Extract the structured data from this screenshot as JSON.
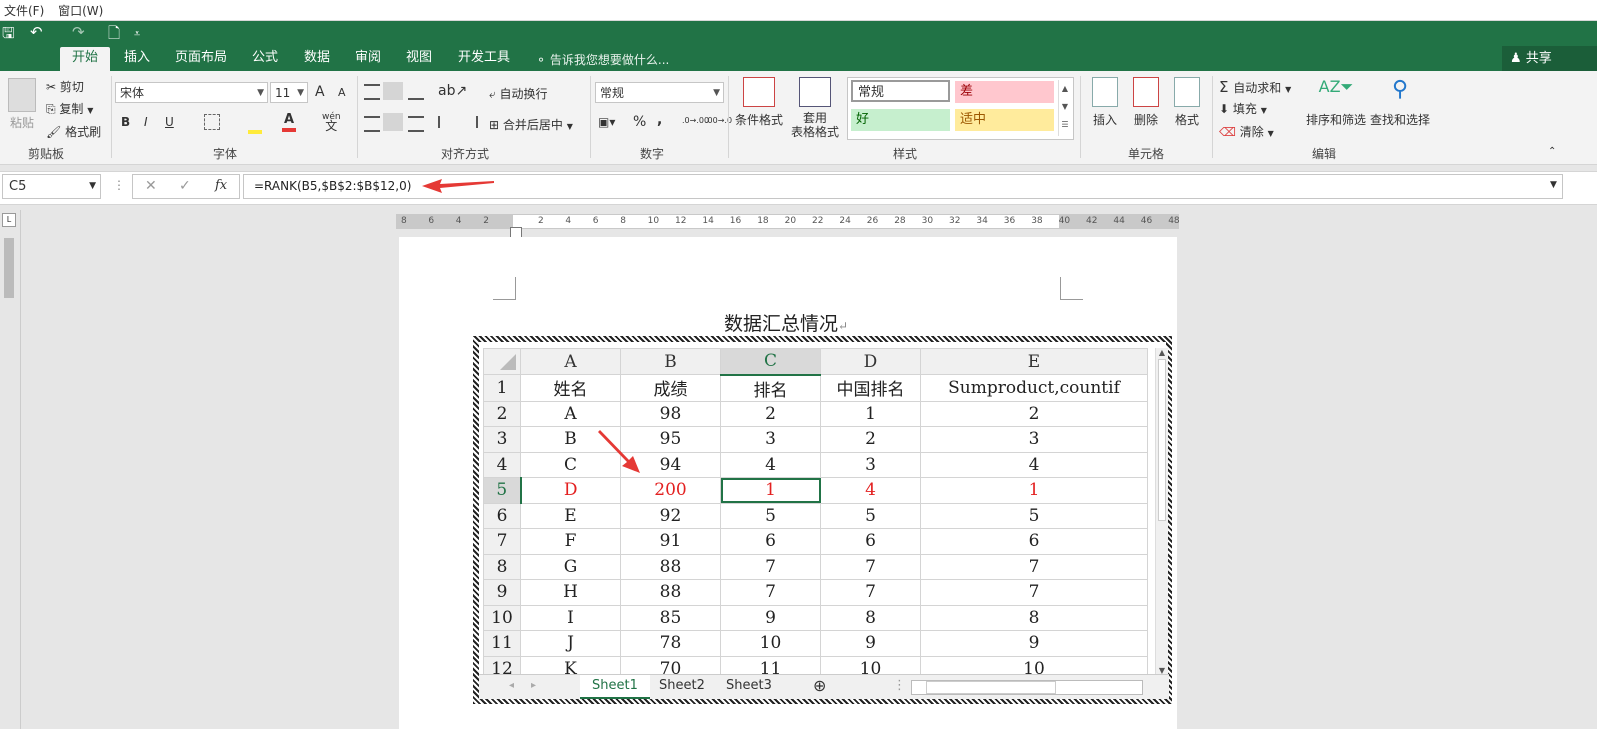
{
  "menubar": {
    "file": "文件(F)",
    "window": "窗口(W)"
  },
  "qat": {
    "save": "🖫",
    "undo": "↶",
    "redo": "↷",
    "preview": "🗋",
    "more": "⩡"
  },
  "tabs": [
    "开始",
    "插入",
    "页面布局",
    "公式",
    "数据",
    "审阅",
    "视图",
    "开发工具"
  ],
  "tellme": "告诉我您想要做什么...",
  "share": "共享",
  "ribbon": {
    "clipboard": {
      "paste": "粘贴",
      "cut": "剪切",
      "copy": "复制",
      "painter": "格式刷",
      "group": "剪贴板"
    },
    "font": {
      "name": "宋体",
      "size": "11",
      "group": "字体",
      "grow": "A",
      "shrink": "A",
      "bold": "B",
      "italic": "I",
      "underline": "U",
      "wen": "wén",
      "wen2": "文"
    },
    "align": {
      "wrap": "自动换行",
      "merge": "合并后居中",
      "group": "对齐方式"
    },
    "number": {
      "format": "常规",
      "group": "数字",
      "pct": "%",
      "comma": ",",
      "inc": ".0→.00",
      "dec": ".00→.0"
    },
    "styles": {
      "cond": "条件格式",
      "table1": "套用",
      "table2": "表格格式",
      "normal": "常规",
      "bad": "差",
      "good": "好",
      "neutral": "适中",
      "group": "样式"
    },
    "cells": {
      "insert": "插入",
      "delete": "删除",
      "format": "格式",
      "group": "单元格"
    },
    "edit": {
      "autosum": "自动求和",
      "fill": "填充",
      "clear": "清除",
      "sort": "排序和筛选",
      "find": "查找和选择",
      "group": "编辑"
    }
  },
  "formula_bar": {
    "namebox": "C5",
    "formula": "=RANK(B5,$B$2:$B$12,0)",
    "cancel": "✕",
    "enter": "✓",
    "fx": "fx"
  },
  "ruler_ticks": [
    "8",
    "6",
    "4",
    "2",
    "",
    "2",
    "4",
    "6",
    "8",
    "10",
    "12",
    "14",
    "16",
    "18",
    "20",
    "22",
    "24",
    "26",
    "28",
    "30",
    "32",
    "34",
    "36",
    "38",
    "40",
    "42",
    "44",
    "46",
    "48"
  ],
  "document": {
    "title": "数据汇总情况",
    "mark": "↵"
  },
  "sheet": {
    "col_headers": [
      "A",
      "B",
      "C",
      "D",
      "E"
    ],
    "rows": [
      {
        "n": "1",
        "cells": [
          "姓名",
          "成绩",
          "排名",
          "中国排名",
          "Sumproduct,countif"
        ]
      },
      {
        "n": "2",
        "cells": [
          "A",
          "98",
          "2",
          "1",
          "2"
        ]
      },
      {
        "n": "3",
        "cells": [
          "B",
          "95",
          "3",
          "2",
          "3"
        ]
      },
      {
        "n": "4",
        "cells": [
          "C",
          "94",
          "4",
          "3",
          "4"
        ]
      },
      {
        "n": "5",
        "cells": [
          "D",
          "200",
          "1",
          "4",
          "1"
        ]
      },
      {
        "n": "6",
        "cells": [
          "E",
          "92",
          "5",
          "5",
          "5"
        ]
      },
      {
        "n": "7",
        "cells": [
          "F",
          "91",
          "6",
          "6",
          "6"
        ]
      },
      {
        "n": "8",
        "cells": [
          "G",
          "88",
          "7",
          "7",
          "7"
        ]
      },
      {
        "n": "9",
        "cells": [
          "H",
          "88",
          "7",
          "7",
          "7"
        ]
      },
      {
        "n": "10",
        "cells": [
          "I",
          "85",
          "9",
          "8",
          "8"
        ]
      },
      {
        "n": "11",
        "cells": [
          "J",
          "78",
          "10",
          "9",
          "9"
        ]
      },
      {
        "n": "12",
        "cells": [
          "K",
          "70",
          "11",
          "10",
          "10"
        ]
      }
    ],
    "sheet_tabs": [
      "Sheet1",
      "Sheet2",
      "Sheet3"
    ],
    "add_sheet": "⊕"
  },
  "colors": {
    "accent": "#217346",
    "highlight_red": "#e32020",
    "arrow": "#e53935"
  }
}
